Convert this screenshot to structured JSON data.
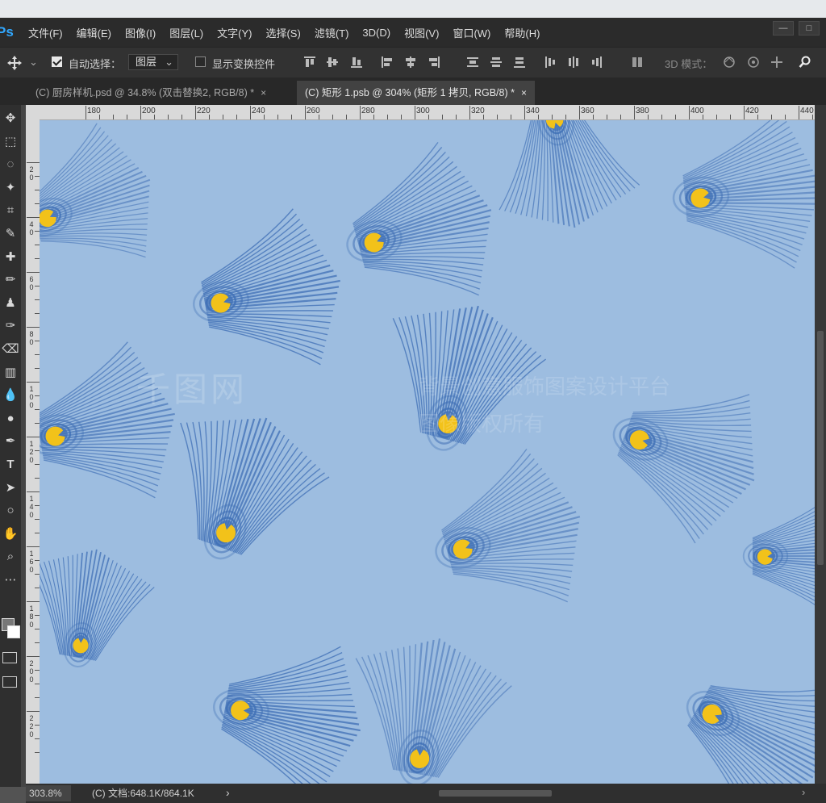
{
  "app": {
    "logo": "Ps"
  },
  "menu": [
    "文件(F)",
    "编辑(E)",
    "图像(I)",
    "图层(L)",
    "文字(Y)",
    "选择(S)",
    "滤镜(T)",
    "3D(D)",
    "视图(V)",
    "窗口(W)",
    "帮助(H)"
  ],
  "window_controls": {
    "minimize": "—",
    "maximize": "□"
  },
  "options_bar": {
    "auto_select_label": "自动选择：",
    "auto_select_checked": true,
    "layer_select_value": "图层",
    "show_transform_label": "显示变换控件",
    "show_transform_checked": false,
    "mode_3d_label": "3D 模式："
  },
  "tabs": [
    {
      "label": "(C) 厨房样机.psd @ 34.8% (双击替换2, RGB/8) *",
      "close": "×",
      "active": false
    },
    {
      "label": "(C) 矩形 1.psb @ 304% (矩形 1 拷贝, RGB/8) *",
      "close": "×",
      "active": true
    }
  ],
  "ruler_top_labels": [
    "180",
    "200",
    "220",
    "240",
    "260",
    "280",
    "300",
    "320",
    "340",
    "360",
    "380",
    "400",
    "420",
    "440"
  ],
  "ruler_left_labels": [
    "2 0",
    "4 0",
    "6 0",
    "8 0",
    "1 0 0",
    "1 2 0",
    "1 4 0",
    "1 6 0",
    "1 8 0",
    "2 0 0",
    "2 2 0"
  ],
  "canvas": {
    "background": "#9dbde0",
    "feather_color": "#3f6fb5",
    "eye_color": "#f2c21a",
    "watermark_brand": "千图网",
    "watermark_line1": "背景创意服饰图案设计平台",
    "watermark_line2": "图像版权所有"
  },
  "status": {
    "zoom": "303.8%",
    "doc_info": "(C) 文档:648.1K/864.1K",
    "arrow": "›"
  },
  "tools": [
    "move-tool",
    "marquee-tool",
    "lasso-tool",
    "magic-wand-tool",
    "crop-tool",
    "eyedropper-tool",
    "healing-brush-tool",
    "brush-tool",
    "clone-stamp-tool",
    "history-brush-tool",
    "eraser-tool",
    "gradient-tool",
    "blur-tool",
    "dodge-tool",
    "pen-tool",
    "type-tool",
    "path-selection-tool",
    "ellipse-tool",
    "hand-tool",
    "zoom-tool",
    "more-tools"
  ]
}
